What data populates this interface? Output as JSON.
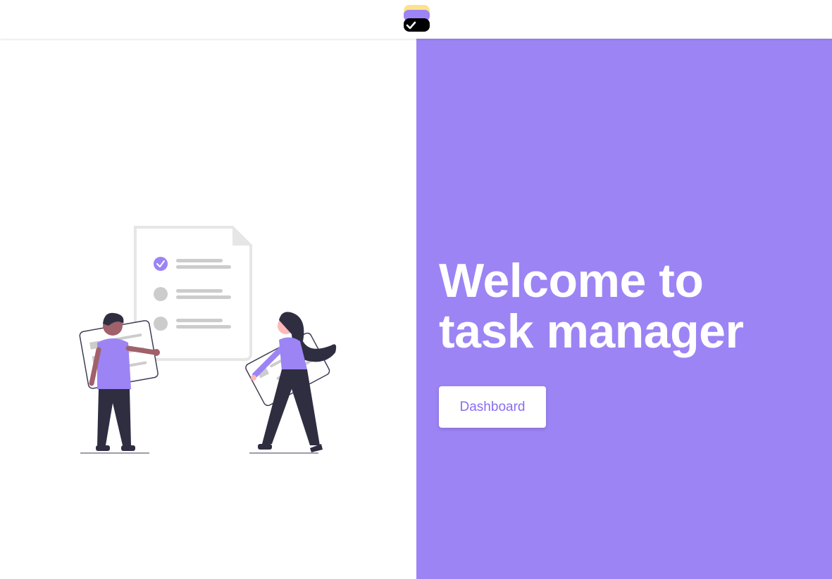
{
  "colors": {
    "accent": "#9c84f5",
    "button_text": "#8a6df0",
    "logo_yellow": "#fde28b",
    "logo_purple": "#9c84f5",
    "logo_black": "#000000"
  },
  "header": {
    "logo_icon": "task-check-logo-icon"
  },
  "illustration": {
    "icon": "people-with-checklist-illustration"
  },
  "hero": {
    "title_line1": "Welcome to",
    "title_line2": "task manager",
    "button_label": "Dashboard"
  }
}
